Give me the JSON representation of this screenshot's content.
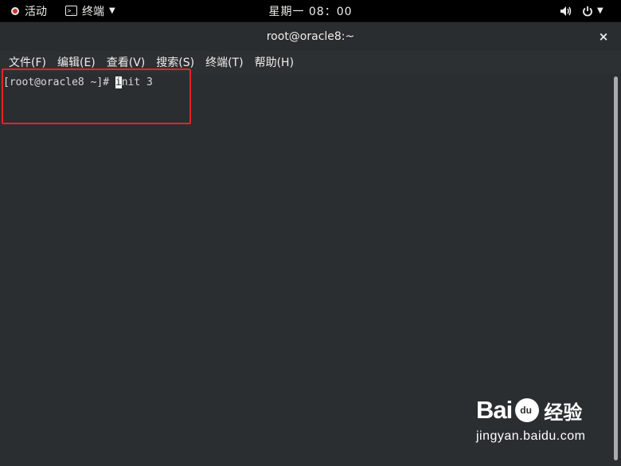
{
  "topbar": {
    "activities_label": "活动",
    "app_icon_glyph": ">_",
    "app_menu_label": "终端",
    "clock": "星期一 08：00",
    "volume_icon": "volume-icon",
    "power_icon": "power-icon"
  },
  "window": {
    "title": "root@oracle8:~",
    "close_glyph": "×"
  },
  "menubar": {
    "items": [
      {
        "label": "文件(F)"
      },
      {
        "label": "编辑(E)"
      },
      {
        "label": "查看(V)"
      },
      {
        "label": "搜索(S)"
      },
      {
        "label": "终端(T)"
      },
      {
        "label": "帮助(H)"
      }
    ]
  },
  "terminal": {
    "prompt": "[root@oracle8 ~]# ",
    "cursor_char": "i",
    "command_rest": "nit 3"
  },
  "watermark": {
    "brand_a": "Bai",
    "brand_cn": "经验",
    "url": "jingyan.baidu.com"
  },
  "colors": {
    "highlight": "#e0252b",
    "terminal_bg": "#2b2e30",
    "topbar_bg": "#000000"
  }
}
